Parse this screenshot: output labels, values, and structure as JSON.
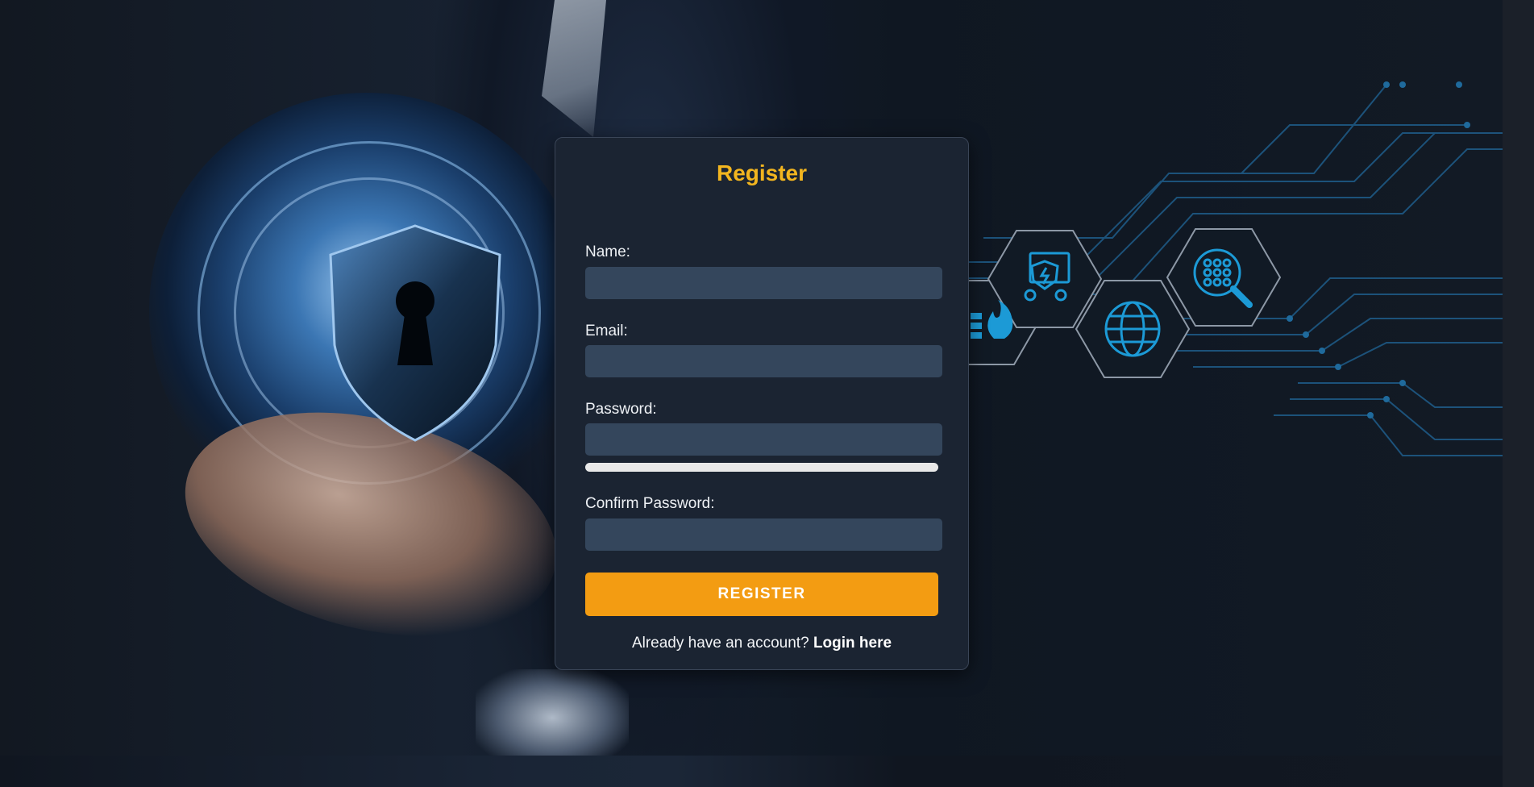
{
  "form": {
    "title": "Register",
    "fields": [
      {
        "label": "Name:",
        "value": "",
        "placeholder": ""
      },
      {
        "label": "Email:",
        "value": "",
        "placeholder": ""
      },
      {
        "label": "Password:",
        "value": "",
        "placeholder": ""
      },
      {
        "label": "Confirm Password:",
        "value": "",
        "placeholder": ""
      }
    ],
    "password_strength": 0,
    "submit_label": "REGISTER",
    "footer_prompt": "Already have an account?",
    "login_link": "Login here"
  },
  "colors": {
    "accent": "#f39c12",
    "title": "#f2b51f",
    "card": "#1b2432",
    "input": "#34465c",
    "background": "#151b24"
  },
  "icons": [
    "shield-keyhole-icon",
    "firewall-icon",
    "settings-shield-icon",
    "globe-icon",
    "search-network-icon"
  ]
}
